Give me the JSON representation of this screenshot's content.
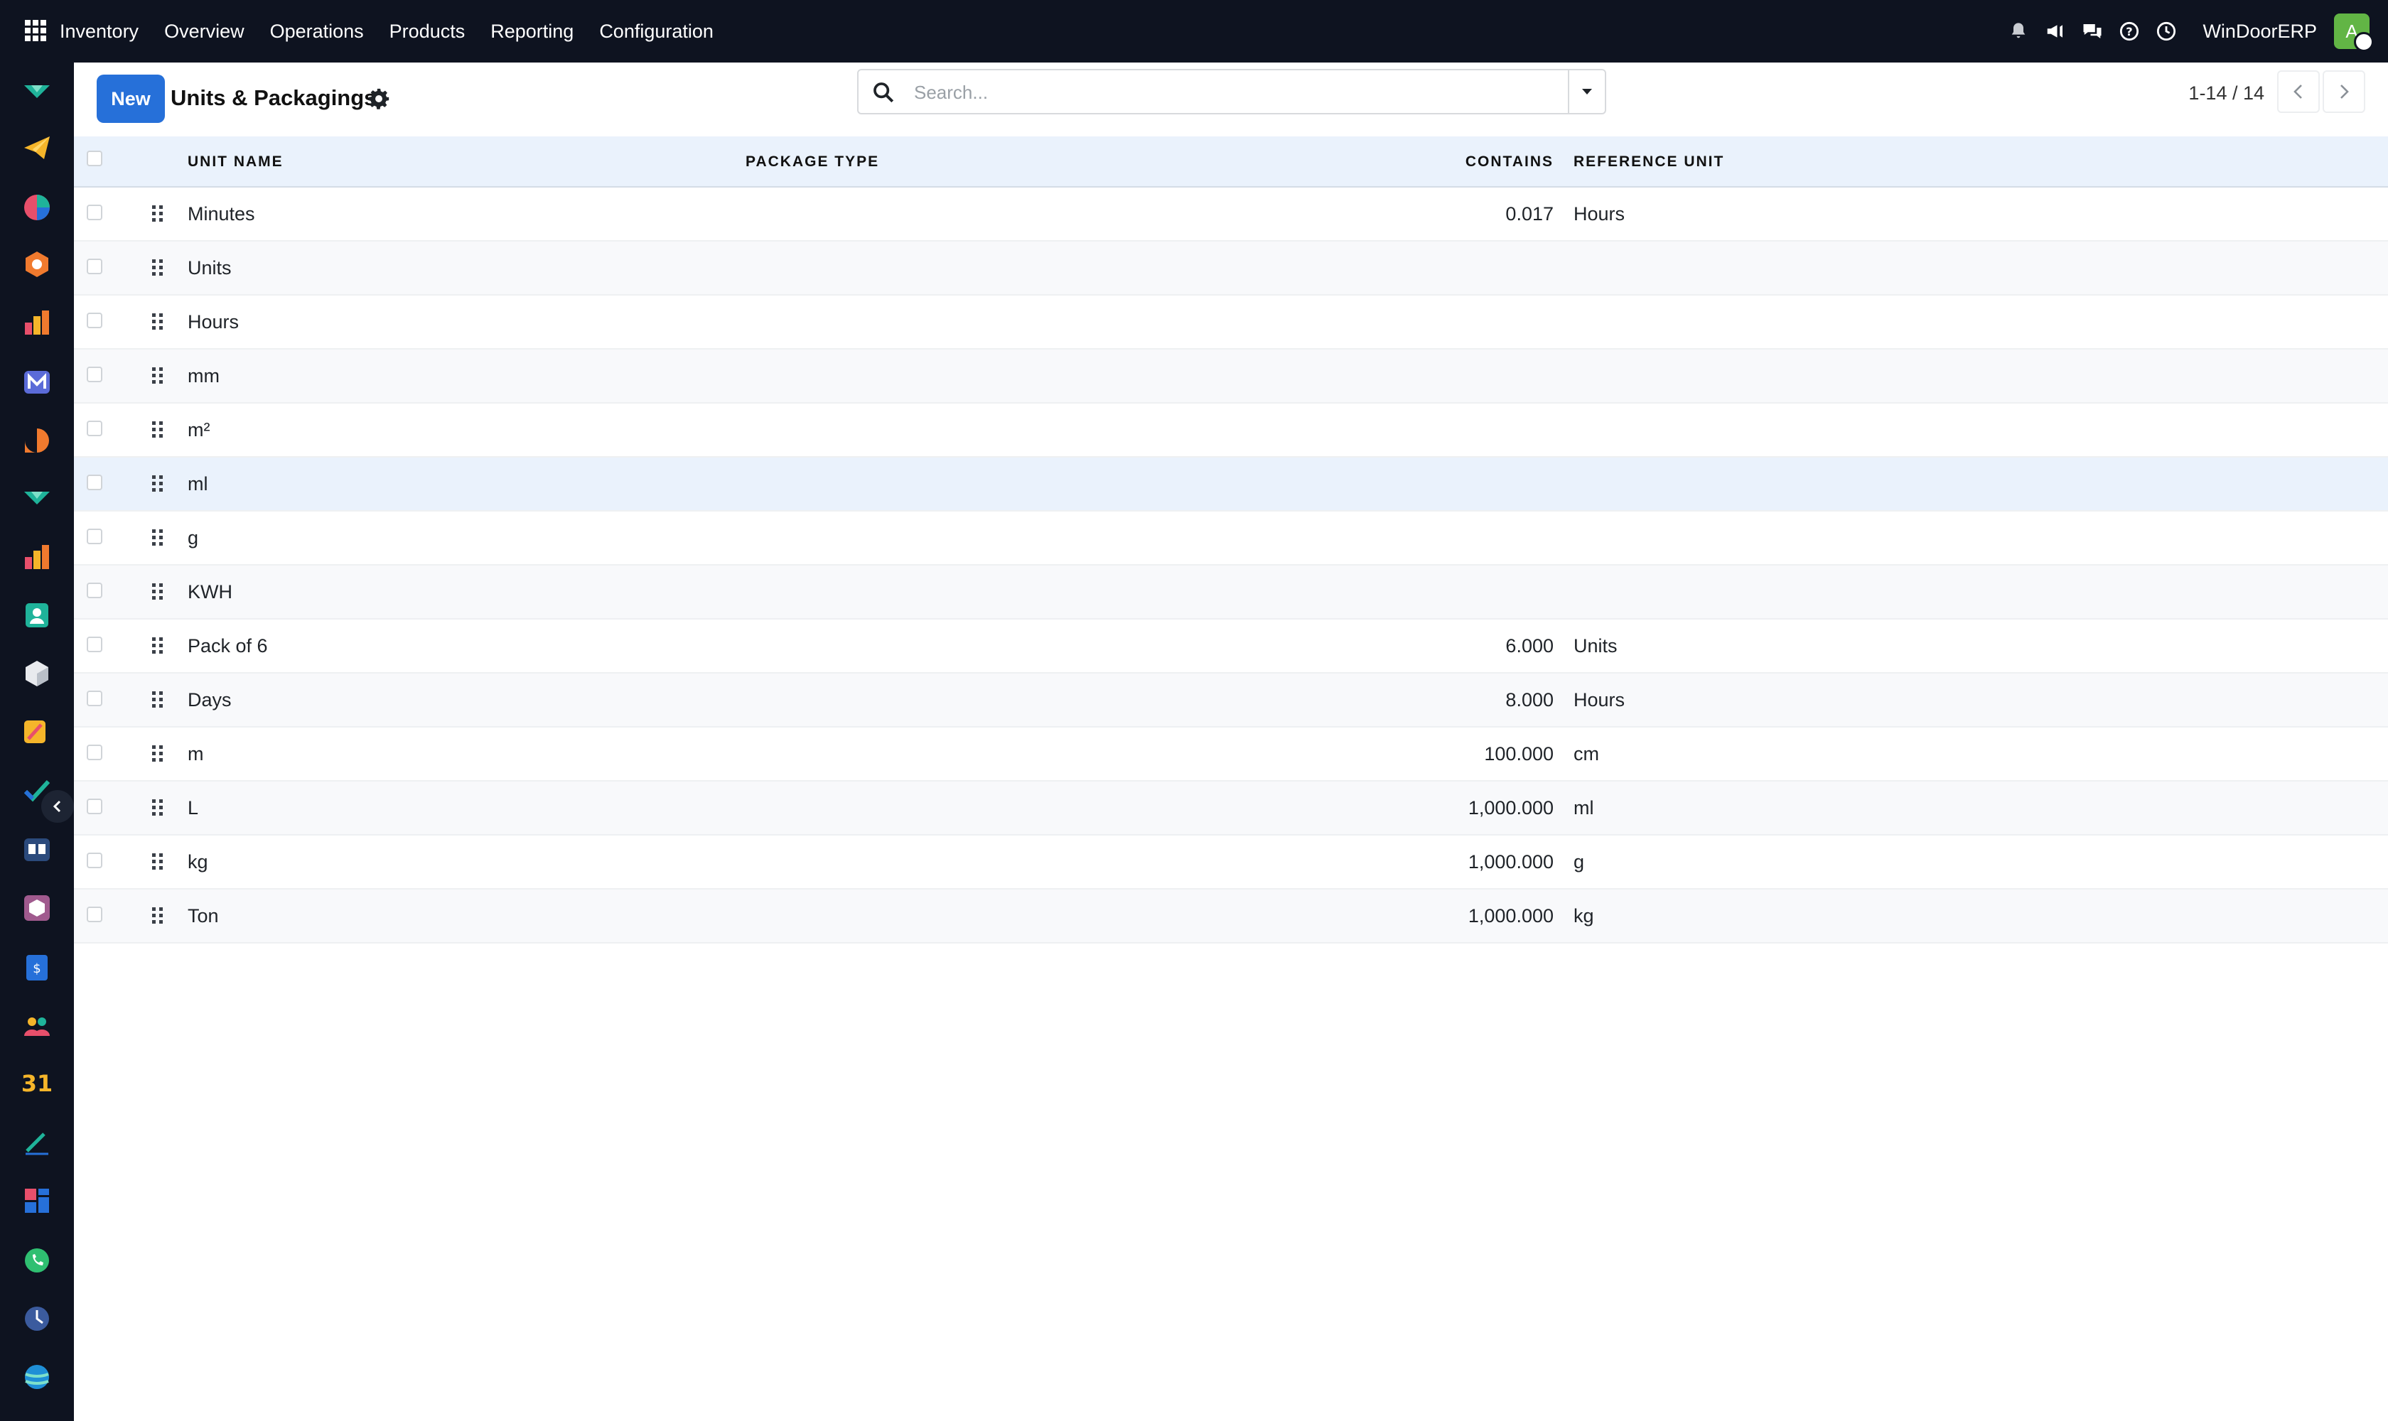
{
  "topbar": {
    "menu": [
      "Inventory",
      "Overview",
      "Operations",
      "Products",
      "Reporting",
      "Configuration"
    ],
    "company": "WinDoorERP",
    "avatar_letter": "A",
    "icons": [
      "bell-icon",
      "megaphone-icon",
      "chat-icon",
      "help-icon",
      "clock-icon"
    ]
  },
  "rail": {
    "apps": [
      "discuss-app-icon",
      "telegram-app-icon",
      "dashboard-app-icon",
      "inventory-app-icon",
      "reporting-app-icon",
      "mail-app-icon",
      "chat-bubble-app-icon",
      "discuss-app-icon",
      "reporting-app-icon",
      "contacts-app-icon",
      "box-app-icon",
      "studio-app-icon",
      "tasks-app-icon",
      "knowledge-app-icon",
      "product-app-icon",
      "invoicing-app-icon",
      "employees-app-icon",
      "calendar-app-icon",
      "sign-app-icon",
      "dashboards-app-icon",
      "whatsapp-app-icon",
      "clock-app-icon",
      "website-app-icon"
    ],
    "calendar_text": "31"
  },
  "control": {
    "new_label": "New",
    "title": "Units & Packagings",
    "search_placeholder": "Search...",
    "pager": "1-14 / 14"
  },
  "table": {
    "headers": {
      "name": "UNIT NAME",
      "package_type": "PACKAGE TYPE",
      "contains": "CONTAINS",
      "reference_unit": "REFERENCE UNIT"
    },
    "rows": [
      {
        "name": "Minutes",
        "package_type": "",
        "contains": "0.017",
        "reference_unit": "Hours"
      },
      {
        "name": "Units",
        "package_type": "",
        "contains": "",
        "reference_unit": ""
      },
      {
        "name": "Hours",
        "package_type": "",
        "contains": "",
        "reference_unit": ""
      },
      {
        "name": "mm",
        "package_type": "",
        "contains": "",
        "reference_unit": ""
      },
      {
        "name": "m²",
        "package_type": "",
        "contains": "",
        "reference_unit": ""
      },
      {
        "name": "ml",
        "package_type": "",
        "contains": "",
        "reference_unit": ""
      },
      {
        "name": "g",
        "package_type": "",
        "contains": "",
        "reference_unit": ""
      },
      {
        "name": "KWH",
        "package_type": "",
        "contains": "",
        "reference_unit": ""
      },
      {
        "name": "Pack of 6",
        "package_type": "",
        "contains": "6.000",
        "reference_unit": "Units"
      },
      {
        "name": "Days",
        "package_type": "",
        "contains": "8.000",
        "reference_unit": "Hours"
      },
      {
        "name": "m",
        "package_type": "",
        "contains": "100.000",
        "reference_unit": "cm"
      },
      {
        "name": "L",
        "package_type": "",
        "contains": "1,000.000",
        "reference_unit": "ml"
      },
      {
        "name": "kg",
        "package_type": "",
        "contains": "1,000.000",
        "reference_unit": "g"
      },
      {
        "name": "Ton",
        "package_type": "",
        "contains": "1,000.000",
        "reference_unit": "kg"
      }
    ],
    "highlighted_row": 5
  },
  "colors": {
    "navbar": "#0e1320",
    "primary": "#2670d9",
    "header_bg": "#eaf2fc",
    "avatar": "#62b545"
  }
}
